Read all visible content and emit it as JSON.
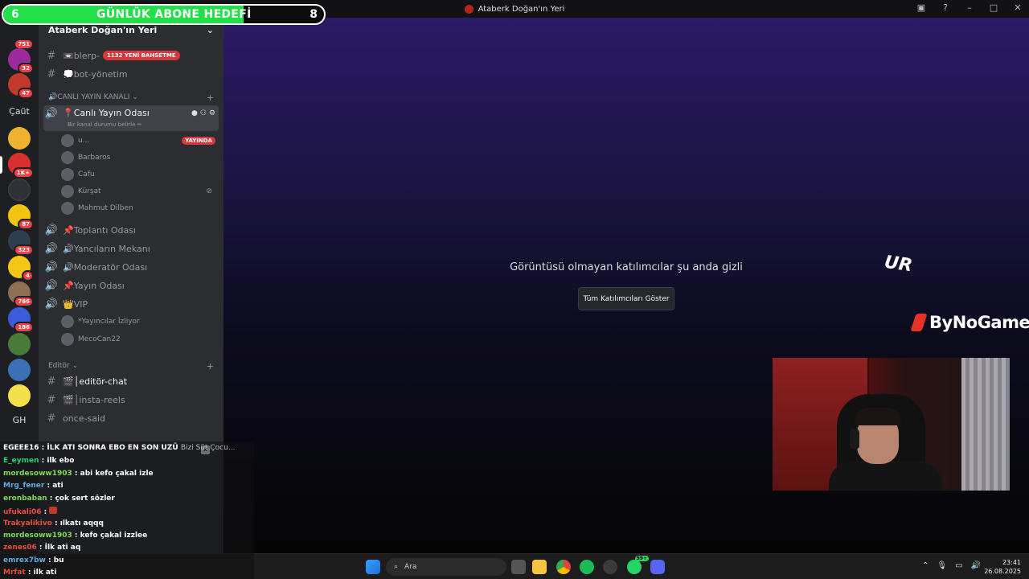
{
  "window": {
    "title": "Ataberk Doğan'ın Yeri",
    "controls": [
      "inbox-icon",
      "help-icon",
      "minimize-icon",
      "maximize-icon",
      "close-icon"
    ]
  },
  "goal": {
    "current": "6",
    "target": "8",
    "label": "GÜNLÜK ABONE HEDEFİ",
    "progress_fraction": 0.75,
    "color": "#22e04a"
  },
  "servers": [
    {
      "badge": "751",
      "color": "#5865f2"
    },
    {
      "badge": "32",
      "color": "#9b2b9b"
    },
    {
      "badge": "47",
      "color": "#c0392b"
    },
    {
      "text": "Çaüt"
    },
    {
      "badge": "",
      "color": "#f0b232"
    },
    {
      "badge": "1K+",
      "color": "#d63031"
    },
    {
      "badge": "",
      "color": "#2f3136"
    },
    {
      "badge": "87",
      "color": "#f1c40f"
    },
    {
      "badge": "323",
      "color": "#2c3e50"
    },
    {
      "badge": "4",
      "color": "#f5c518"
    },
    {
      "badge": "766",
      "color": "#8e6e53"
    },
    {
      "badge": "186",
      "color": "#3b5bdb"
    },
    {
      "badge": "",
      "color": "#4a7a3a"
    },
    {
      "badge": "",
      "color": "#3d6fb4"
    },
    {
      "badge": "",
      "color": "#f4e04d"
    },
    {
      "text": "GH"
    }
  ],
  "sidebar": {
    "server_name": "Ataberk Doğan'ın Yeri",
    "channels": {
      "blerp": {
        "name": "📼blerp-",
        "mention": "1132 YENİ BAHSETME"
      },
      "bot": {
        "name": "💭bot-yönetim"
      }
    },
    "categories": {
      "live": "🔊CANLI YAYIN KANALI",
      "editor": "Editör"
    },
    "live_room": {
      "name": "📍Canlı Yayın Odası",
      "status_hint": "Bir kanal durumu belirle ✏"
    },
    "voice_users": [
      {
        "name": "u...",
        "live": "YAYINDA"
      },
      {
        "name": "Barbaros"
      },
      {
        "name": "Cafu"
      },
      {
        "name": "Kürşat"
      },
      {
        "name": "Mahmut Dilben"
      }
    ],
    "rooms": [
      "📌Toplantı Odası",
      "🔊Yancıların Mekanı",
      "🔊Moderatör Odası",
      "📌Yayın Odası",
      "👑VIP"
    ],
    "vip_users": [
      "*Yayıncılar İzliyor",
      "MecoCan22"
    ],
    "editor_channels": [
      "🎬│editör-chat",
      "🎬│insta-reels",
      "once-said"
    ]
  },
  "main": {
    "hidden_message": "Görüntüsü olmayan katılımcılar şu anda gizli",
    "show_button": "Tüm Katılımcıları Göster",
    "overlay_text": "UR",
    "sponsor": "ByNoGame"
  },
  "chat": [
    {
      "user": "EGEEE16 : İLK ATI SONRA EBO EN SON UZÜ",
      "text": "Bizi Süt Çocu...",
      "color": "#ffffff"
    },
    {
      "user": "E_eymen",
      "text": "ilk ebo",
      "color": "#2ecc71"
    },
    {
      "user": "mordesoww1903",
      "text": "abi kefo çakal izle",
      "color": "#7ed957"
    },
    {
      "user": "Mrg_fener",
      "text": "ati",
      "color": "#5dade2"
    },
    {
      "user": "eronbaban",
      "text": "çok sert sözler",
      "color": "#7ed957"
    },
    {
      "user": "ufukali06",
      "text": "",
      "color": "#e74c3c"
    },
    {
      "user": "Trakyalikivo",
      "text": "ılkatı aqqq",
      "color": "#e74c3c"
    },
    {
      "user": "mordesoww1903",
      "text": "kefo çakal izzlee",
      "color": "#7ed957"
    },
    {
      "user": "zenes06",
      "text": "İlk ati aq",
      "color": "#e74c3c"
    },
    {
      "user": "emrex7bw",
      "text": "bu",
      "color": "#5dade2"
    },
    {
      "user": "Mrfat",
      "text": "ilk ati",
      "color": "#e74c3c"
    }
  ],
  "taskbar": {
    "search_label": "Ara",
    "chat_badge": "99+",
    "time": "23:41",
    "date": "26.08.2025"
  }
}
